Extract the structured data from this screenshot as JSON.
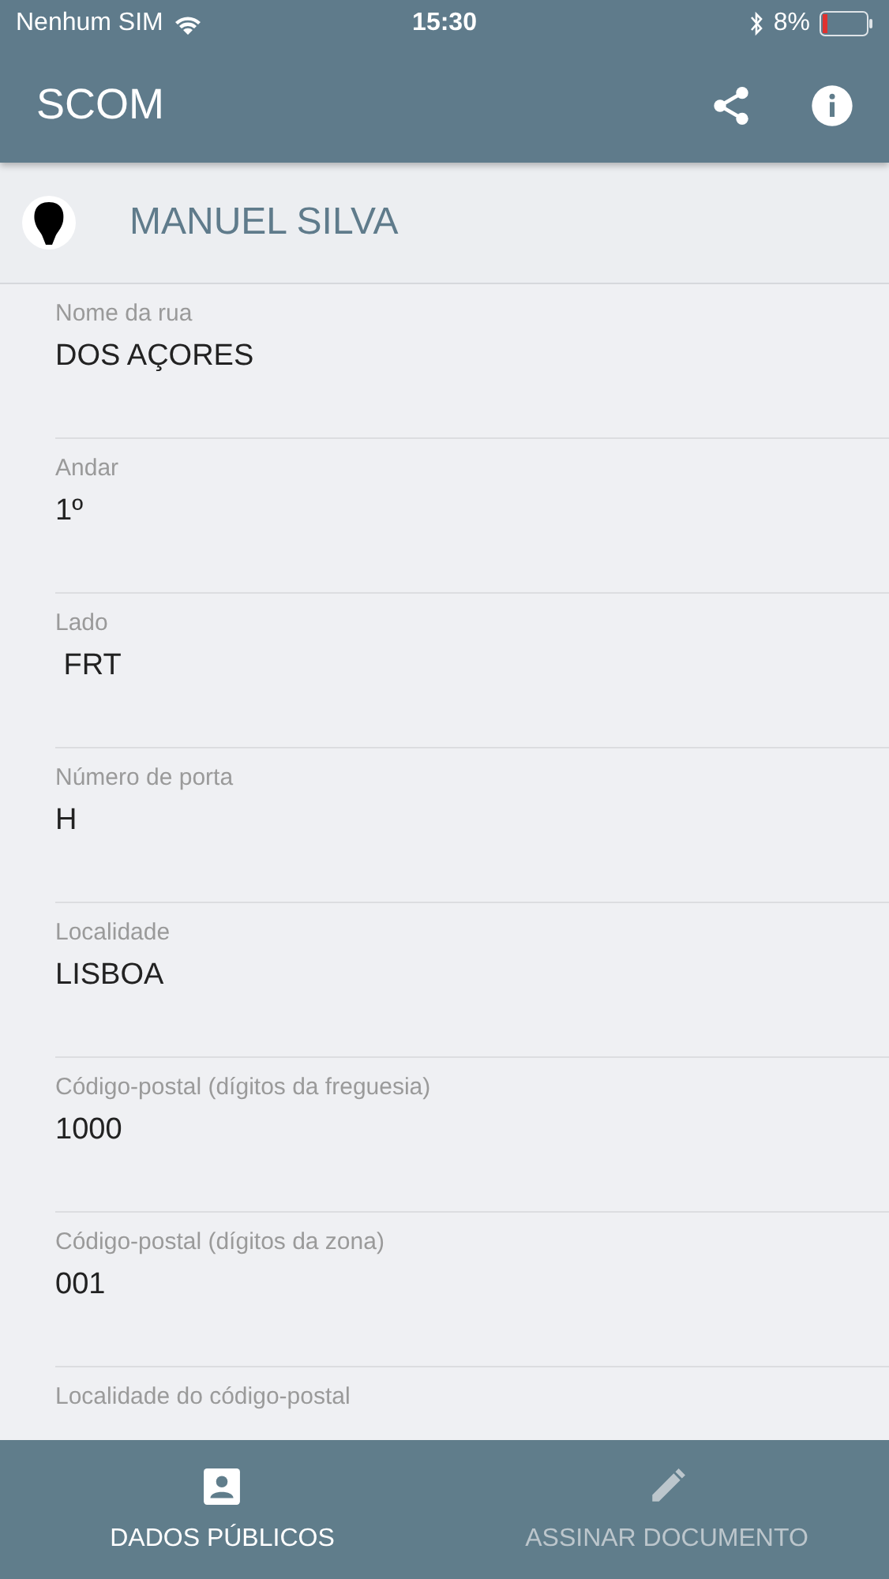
{
  "status_bar": {
    "carrier": "Nenhum SIM",
    "time": "15:30",
    "battery": "8%"
  },
  "app_bar": {
    "title": "SCOM"
  },
  "profile": {
    "name": "MANUEL SILVA"
  },
  "fields": [
    {
      "label": "Nome da rua",
      "value": "DOS AÇORES"
    },
    {
      "label": "Andar",
      "value": "1º"
    },
    {
      "label": "Lado",
      "value": " FRT"
    },
    {
      "label": "Número de porta",
      "value": "H"
    },
    {
      "label": "Localidade",
      "value": "LISBOA"
    },
    {
      "label": "Código-postal (dígitos da freguesia)",
      "value": "1000"
    },
    {
      "label": "Código-postal (dígitos da zona)",
      "value": "001"
    },
    {
      "label": "Localidade do código-postal"
    }
  ],
  "tabs": [
    {
      "label": "DADOS PÚBLICOS",
      "kind": "person",
      "selected": true
    },
    {
      "label": "ASSINAR DOCUMENTO",
      "kind": "pencil",
      "selected": false
    }
  ]
}
